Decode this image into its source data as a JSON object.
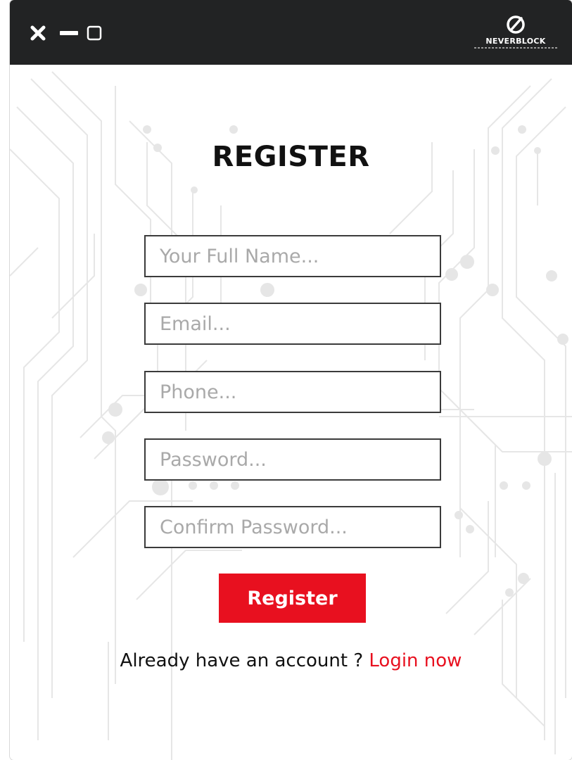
{
  "window": {
    "controls": {
      "close_icon": "close-icon",
      "minimize_icon": "minimize-icon",
      "maximize_icon": "maximize-icon"
    },
    "logo_text": "NEVERBLOCK"
  },
  "form": {
    "title": "REGISTER",
    "fields": [
      {
        "name": "full-name-input",
        "placeholder": "Your Full Name...",
        "value": ""
      },
      {
        "name": "email-input",
        "placeholder": "Email...",
        "value": ""
      },
      {
        "name": "phone-input",
        "placeholder": "Phone...",
        "value": ""
      },
      {
        "name": "password-input",
        "placeholder": "Password...",
        "value": ""
      },
      {
        "name": "confirm-password-input",
        "placeholder": "Confirm Password...",
        "value": ""
      }
    ],
    "submit_label": "Register",
    "footer_prefix": "Already have an account ? ",
    "login_link": "Login now"
  },
  "colors": {
    "titlebar": "#222324",
    "accent": "#e8101f",
    "field_border": "#3b3b3b",
    "placeholder": "#a9a9a9"
  }
}
